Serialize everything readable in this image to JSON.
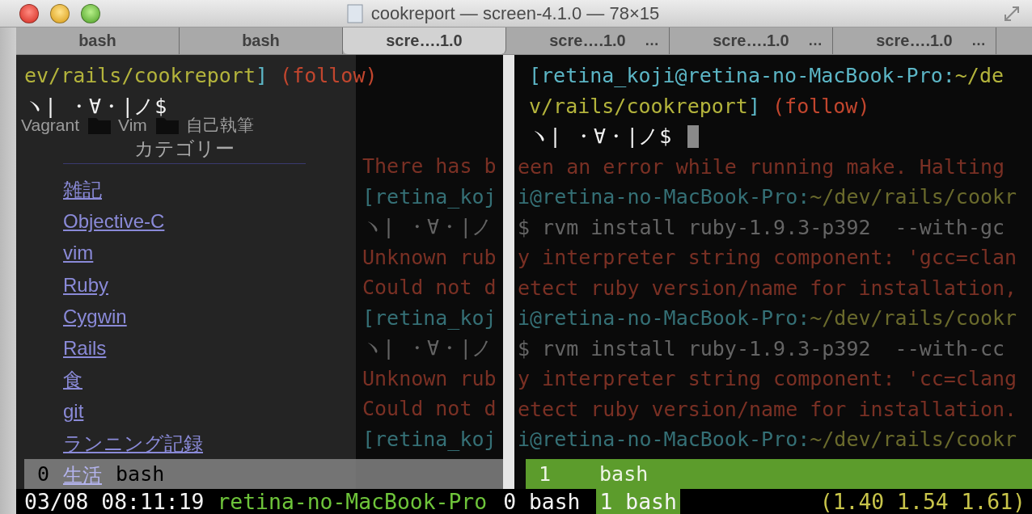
{
  "window": {
    "title": "cookreport — screen-4.1.0 — 78×15"
  },
  "tabs": [
    {
      "label": "bash",
      "selected": false
    },
    {
      "label": "bash",
      "selected": false
    },
    {
      "label": "scre….1.0",
      "selected": true
    },
    {
      "label": "scre….1.0",
      "overflow": "…",
      "selected": false
    },
    {
      "label": "scre….1.0",
      "overflow": "…",
      "selected": false
    },
    {
      "label": "scre….1.0",
      "overflow": "…",
      "selected": false
    }
  ],
  "left_pane": {
    "prompt": [
      [
        {
          "text": "ev/rails/cookreport",
          "color": "#b4b43c"
        },
        {
          "text": "]",
          "color": "#5cb6c6"
        },
        {
          "text": " (follow)",
          "color": "#c2462e"
        }
      ],
      [
        {
          "text": "ヽ| ・∀・|ノ$",
          "color": "#f2f2f2"
        }
      ]
    ],
    "bookmarks": [
      {
        "label": "Vagrant",
        "kind": "plain"
      },
      {
        "label": "Vim",
        "kind": "folder"
      },
      {
        "label": "自己執筆",
        "kind": "folder"
      }
    ],
    "sidebar": {
      "heading": "カテゴリー",
      "links": [
        "雑記",
        "Objective-C",
        "vim",
        "Ruby",
        "Cygwin",
        "Rails",
        "食",
        "git",
        "ランニング記録",
        "生活"
      ]
    },
    "history": [
      [
        {
          "text": "There has b",
          "color": "#7a3024"
        }
      ],
      [
        {
          "text": "[retina_koj",
          "color": "#357076"
        }
      ],
      [
        {
          "text": "ヽ| ・∀・|ノ",
          "color": "#646464"
        }
      ],
      [
        {
          "text": "Unknown rub",
          "color": "#7a3024"
        }
      ],
      [
        {
          "text": "Could not d",
          "color": "#7a3024"
        }
      ],
      [
        {
          "text": "[retina_koj",
          "color": "#357076"
        }
      ],
      [
        {
          "text": "ヽ| ・∀・|ノ",
          "color": "#646464"
        }
      ],
      [
        {
          "text": "Unknown rub",
          "color": "#7a3024"
        }
      ],
      [
        {
          "text": "Could not d",
          "color": "#7a3024"
        }
      ],
      [
        {
          "text": "[retina_koj",
          "color": "#357076"
        }
      ]
    ],
    "caption": {
      "number": "0",
      "name": "bash",
      "active": false
    }
  },
  "right_pane": {
    "cursor": true,
    "prompt": [
      [
        {
          "text": "[retina_koji@retina-no-MacBook-Pro:",
          "color": "#5cb6c6"
        },
        {
          "text": "~/de",
          "color": "#b4b43c"
        }
      ],
      [
        {
          "text": "v/rails/cookreport",
          "color": "#b4b43c"
        },
        {
          "text": "]",
          "color": "#5cb6c6"
        },
        {
          "text": " (follow)",
          "color": "#c2462e"
        }
      ],
      [
        {
          "text": "ヽ| ・∀・|ノ$",
          "color": "#f2f2f2"
        }
      ]
    ],
    "history": [
      [
        {
          "text": "een an error while running make. Halting",
          "color": "#7a3024"
        }
      ],
      [
        {
          "text": "i@retina-no-MacBook-Pro:",
          "color": "#357076"
        },
        {
          "text": "~/dev/rails/cookr",
          "color": "#6a6a2c"
        }
      ],
      [
        {
          "text": "$ rvm install ruby-1.9.3-p392  --with-gc",
          "color": "#646464"
        }
      ],
      [
        {
          "text": "y interpreter string component: 'gcc=clan",
          "color": "#7a3024"
        }
      ],
      [
        {
          "text": "etect ruby version/name for installation,",
          "color": "#7a3024"
        }
      ],
      [
        {
          "text": "i@retina-no-MacBook-Pro:",
          "color": "#357076"
        },
        {
          "text": "~/dev/rails/cookr",
          "color": "#6a6a2c"
        }
      ],
      [
        {
          "text": "$ rvm install ruby-1.9.3-p392  --with-cc",
          "color": "#646464"
        }
      ],
      [
        {
          "text": "y interpreter string component: 'cc=clang",
          "color": "#7a3024"
        }
      ],
      [
        {
          "text": "etect ruby version/name for installation.",
          "color": "#7a3024"
        }
      ],
      [
        {
          "text": "i@retina-no-MacBook-Pro:",
          "color": "#357076"
        },
        {
          "text": "~/dev/rails/cookr",
          "color": "#6a6a2c"
        }
      ]
    ],
    "caption": {
      "number": "1",
      "name": "bash",
      "active": true
    }
  },
  "hardstatus": {
    "date": "03/08 08:11:19",
    "host": "retina-no-MacBook-Pro",
    "windows": [
      {
        "label": "0 bash",
        "selected": false
      },
      {
        "label": "1 bash",
        "selected": true
      }
    ],
    "load": "(1.40 1.54 1.61)"
  }
}
